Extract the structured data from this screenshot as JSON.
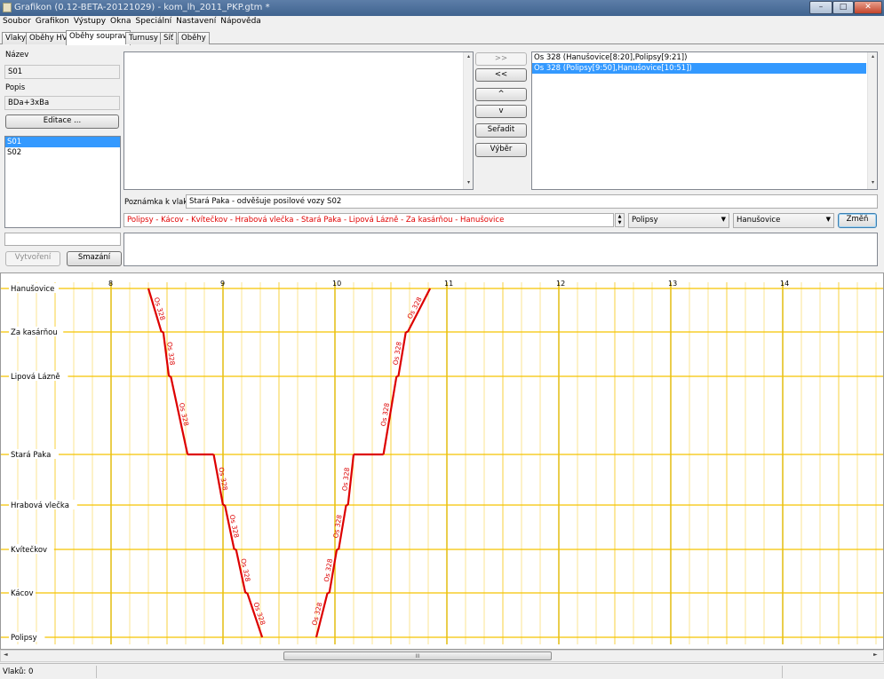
{
  "window": {
    "title": "Grafikon (0.12-BETA-20121029) - kom_lh_2011_PKP.gtm *",
    "minimize_icon": "minimize-icon",
    "maximize_icon": "maximize-icon",
    "close_icon": "close-icon",
    "minimize_glyph": "–",
    "maximize_glyph": "□",
    "close_glyph": "✕"
  },
  "menu": [
    "Soubor",
    "Grafikon",
    "Výstupy",
    "Okna",
    "Speciální",
    "Nastavení",
    "Nápověda"
  ],
  "tabs": [
    {
      "label": "Vlaky",
      "active": false
    },
    {
      "label": "Oběhy HV",
      "active": false
    },
    {
      "label": "Oběhy souprav",
      "active": true
    },
    {
      "label": "Turnusy",
      "active": false
    },
    {
      "label": "Síť",
      "active": false
    },
    {
      "label": "Oběhy",
      "active": false
    }
  ],
  "left_panel": {
    "name_label": "Název",
    "name_value": "S01",
    "description_label": "Popis",
    "description_value": "BDa+3xBa",
    "edit_button": "Editace ...",
    "circulations": [
      {
        "label": "S01",
        "selected": true
      },
      {
        "label": "S02",
        "selected": false
      }
    ],
    "new_name_value": "",
    "create_button": "Vytvoření",
    "delete_button": "Smazání"
  },
  "middle_buttons": {
    "add": ">>",
    "remove": "<<",
    "up": "^",
    "down": "v",
    "sort": "Seřadit",
    "select": "Výběr"
  },
  "circulation_trains": [
    {
      "label": "Os 328 (Hanušovice[8:20],Polipsy[9:21])",
      "selected": false
    },
    {
      "label": "Os 328 (Polipsy[9:50],Hanušovice[10:51])",
      "selected": true
    }
  ],
  "note": {
    "label": "Poznámka k vlaku:",
    "value": "Stará Paka - odvěšuje posilové vozy S02"
  },
  "route": {
    "value": "Polipsy - Kácov - Kvítečkov - Hrabová vlečka - Stará Paka - Lipová Lázně - Za kasárňou - Hanušovice",
    "color": "#e00000",
    "from_station": "Polipsy",
    "to_station": "Hanušovice",
    "change_button": "Změň"
  },
  "graph": {
    "hours": [
      "8",
      "9",
      "10",
      "11",
      "12",
      "13",
      "14"
    ],
    "stations": [
      "Hanušovice",
      "Za kasárňou",
      "Lipová Lázně",
      "Stará Paka",
      "Hrabová vlečka",
      "Kvítečkov",
      "Kácov",
      "Polipsy"
    ],
    "train_label": "Os 328",
    "grid_color": "#f5c400",
    "hour_line_color": "#e0b800",
    "train_color": "#dd0000",
    "trains": [
      {
        "name": "Os 328",
        "path": [
          [
            "Hanušovice",
            "8:20"
          ],
          [
            "Za kasárňou",
            "8:27"
          ],
          [
            "Za kasárňou",
            "8:28"
          ],
          [
            "Lipová Lázně",
            "8:31"
          ],
          [
            "Lipová Lázně",
            "8:32"
          ],
          [
            "Stará Paka",
            "8:41"
          ],
          [
            "Stará Paka",
            "8:55"
          ],
          [
            "Hrabová vlečka",
            "9:00"
          ],
          [
            "Hrabová vlečka",
            "9:01"
          ],
          [
            "Kvítečkov",
            "9:06"
          ],
          [
            "Kvítečkov",
            "9:07"
          ],
          [
            "Kácov",
            "9:12"
          ],
          [
            "Kácov",
            "9:13"
          ],
          [
            "Polipsy",
            "9:21"
          ]
        ]
      },
      {
        "name": "Os 328",
        "path": [
          [
            "Polipsy",
            "9:50"
          ],
          [
            "Kácov",
            "9:56"
          ],
          [
            "Kácov",
            "9:57"
          ],
          [
            "Kvítečkov",
            "10:01"
          ],
          [
            "Kvítečkov",
            "10:02"
          ],
          [
            "Hrabová vlečka",
            "10:06"
          ],
          [
            "Hrabová vlečka",
            "10:07"
          ],
          [
            "Stará Paka",
            "10:10"
          ],
          [
            "Stará Paka",
            "10:26"
          ],
          [
            "Lipová Lázně",
            "10:33"
          ],
          [
            "Lipová Lázně",
            "10:34"
          ],
          [
            "Za kasárňou",
            "10:38"
          ],
          [
            "Za kasárňou",
            "10:39"
          ],
          [
            "Hanušovice",
            "10:51"
          ]
        ]
      }
    ]
  },
  "scrollbar": {
    "left_arrow": "◄",
    "right_arrow": "►",
    "thumb_grip": "III",
    "up_arrow": "▲",
    "down_arrow": "▼",
    "caret_up": "▴",
    "caret_down": "▾",
    "dropdown_caret": "▼"
  },
  "status": {
    "trains_count": "Vlaků: 0"
  }
}
